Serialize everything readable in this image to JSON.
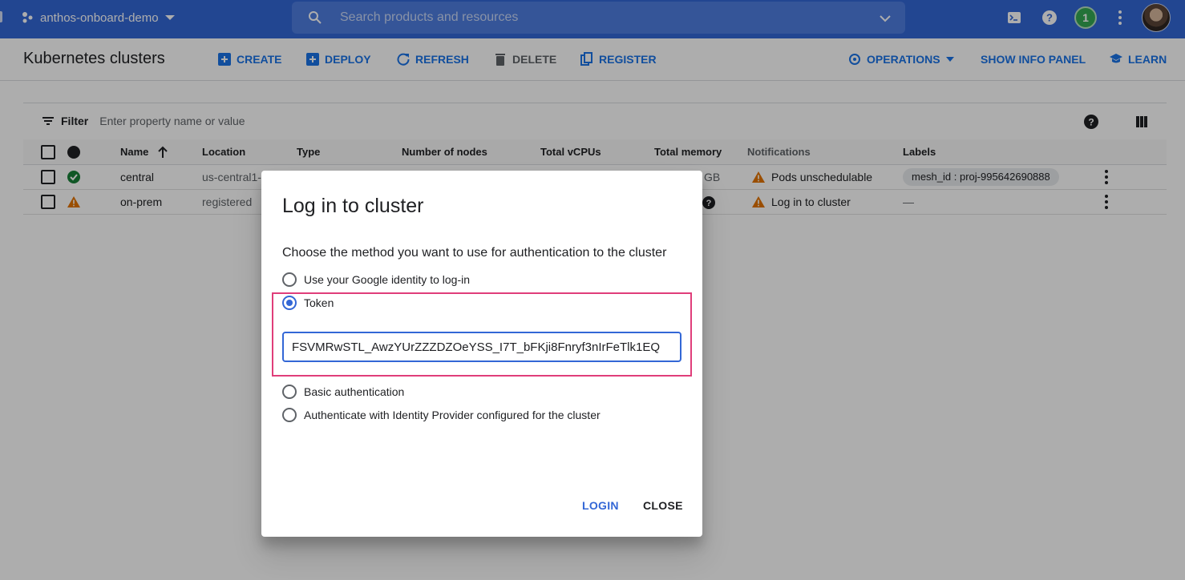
{
  "topbar": {
    "project_name": "anthos-onboard-demo",
    "search_placeholder": "Search products and resources",
    "notification_count": "1"
  },
  "header": {
    "title": "Kubernetes clusters",
    "actions": {
      "create": "CREATE",
      "deploy": "DEPLOY",
      "refresh": "REFRESH",
      "delete": "DELETE",
      "register": "REGISTER",
      "operations": "OPERATIONS",
      "show_info_panel": "SHOW INFO PANEL",
      "learn": "LEARN"
    }
  },
  "filter": {
    "label": "Filter",
    "placeholder": "Enter property name or value"
  },
  "table": {
    "columns": {
      "name": "Name",
      "location": "Location",
      "type": "Type",
      "nodes": "Number of nodes",
      "vcpus": "Total vCPUs",
      "memory": "Total memory",
      "notifications": "Notifications",
      "labels": "Labels"
    },
    "rows": [
      {
        "name": "central",
        "location": "us-central1-",
        "memory_suffix": "GB",
        "notification": "Pods unschedulable",
        "label": "mesh_id : proj-995642690888",
        "status": "ok"
      },
      {
        "name": "on-prem",
        "location": "registered",
        "notification": "Log in to cluster",
        "label": "—",
        "status": "warning"
      }
    ]
  },
  "dialog": {
    "title": "Log in to cluster",
    "description": "Choose the method you want to use for authentication to the cluster",
    "options": [
      "Use your Google identity to log-in",
      "Token",
      "Basic authentication",
      "Authenticate with Identity Provider configured for the cluster"
    ],
    "selected_option": "Token",
    "token_value": "FSVMRwSTL_AwzYUrZZZDZOeYSS_I7T_bFKji8Fnryf3nIrFeTlk1EQ",
    "login_label": "LOGIN",
    "close_label": "CLOSE"
  },
  "colors": {
    "topbar": "#3367d6",
    "accent": "#1a73e8",
    "success": "#188038",
    "warning": "#e37400",
    "highlight": "#e03e7a"
  }
}
